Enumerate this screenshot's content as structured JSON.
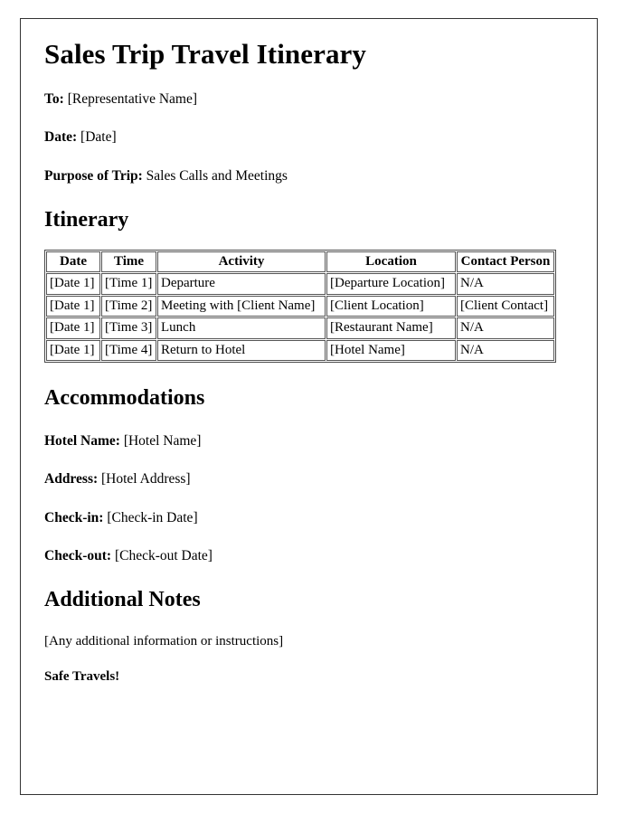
{
  "document": {
    "title": "Sales Trip Travel Itinerary",
    "meta": [
      {
        "label": "To:",
        "value": "[Representative Name]"
      },
      {
        "label": "Date:",
        "value": "[Date]"
      },
      {
        "label": "Purpose of Trip:",
        "value": "Sales Calls and Meetings"
      }
    ],
    "itinerary": {
      "heading": "Itinerary",
      "columns": [
        "Date",
        "Time",
        "Activity",
        "Location",
        "Contact Person"
      ],
      "rows": [
        [
          "[Date 1]",
          "[Time 1]",
          "Departure",
          "[Departure Location]",
          "N/A"
        ],
        [
          "[Date 1]",
          "[Time 2]",
          "Meeting with [Client Name]",
          "[Client Location]",
          "[Client Contact]"
        ],
        [
          "[Date 1]",
          "[Time 3]",
          "Lunch",
          "[Restaurant Name]",
          "N/A"
        ],
        [
          "[Date 1]",
          "[Time 4]",
          "Return to Hotel",
          "[Hotel Name]",
          "N/A"
        ]
      ]
    },
    "accommodations": {
      "heading": "Accommodations",
      "fields": [
        {
          "label": "Hotel Name:",
          "value": "[Hotel Name]"
        },
        {
          "label": "Address:",
          "value": "[Hotel Address]"
        },
        {
          "label": "Check-in:",
          "value": "[Check-in Date]"
        },
        {
          "label": "Check-out:",
          "value": "[Check-out Date]"
        }
      ]
    },
    "additional_notes": {
      "heading": "Additional Notes",
      "body": "[Any additional information or instructions]",
      "closing": "Safe Travels!"
    }
  },
  "colors": {
    "text": "#000000",
    "page_border": "#333333",
    "table_border": "#555555",
    "background": "#ffffff"
  }
}
